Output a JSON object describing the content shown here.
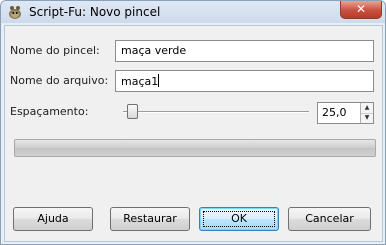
{
  "window": {
    "title": "Script-Fu: Novo pincel",
    "close_label": "✕"
  },
  "form": {
    "brush_name_label": "Nome do pincel:",
    "brush_name_value": "maça verde",
    "file_name_label": "Nome do arquivo:",
    "file_name_value": "maça1",
    "spacing_label": "Espaçamento:",
    "spacing_value": "25,0",
    "spacing_slider_fraction": 0.025
  },
  "buttons": {
    "help": "Ajuda",
    "reset": "Restaurar",
    "ok": "OK",
    "cancel": "Cancelar"
  },
  "icons": {
    "app": "gimp-wilber-icon",
    "close": "close-icon",
    "spin_up": "spin-up-arrow-icon",
    "spin_down": "spin-down-arrow-icon"
  }
}
